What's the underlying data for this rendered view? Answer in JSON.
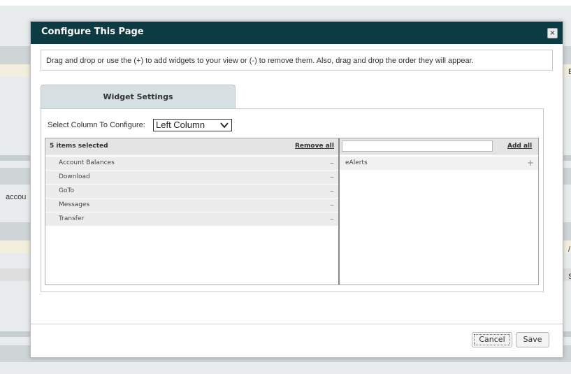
{
  "background": {
    "side_text_left": "accou",
    "right_edge_chars": [
      "E",
      "/",
      "S"
    ]
  },
  "dialog": {
    "title": "Configure This Page",
    "close_label": "×",
    "instructions": "Drag and drop or use the (+) to add widgets to your view or (-) to remove them. Also, drag and drop the order they will appear.",
    "tab_label": "Widget Settings",
    "column_select": {
      "label": "Select Column To Configure:",
      "value": "Left Column"
    },
    "selected_list": {
      "count_label": "5 items selected",
      "remove_all_label": "Remove all",
      "items": [
        {
          "label": "Account Balances",
          "action": "–"
        },
        {
          "label": "Download",
          "action": "–"
        },
        {
          "label": "GoTo",
          "action": "–"
        },
        {
          "label": "Messages",
          "action": "–"
        },
        {
          "label": "Transfer",
          "action": "–"
        }
      ]
    },
    "available_list": {
      "search_value": "",
      "add_all_label": "Add all",
      "items": [
        {
          "label": "eAlerts",
          "action": "+"
        }
      ]
    },
    "buttons": {
      "cancel": "Cancel",
      "save": "Save"
    }
  },
  "colors": {
    "header": "#0c3b44",
    "tab": "#d6dfe1",
    "background": "#e9ecec"
  }
}
